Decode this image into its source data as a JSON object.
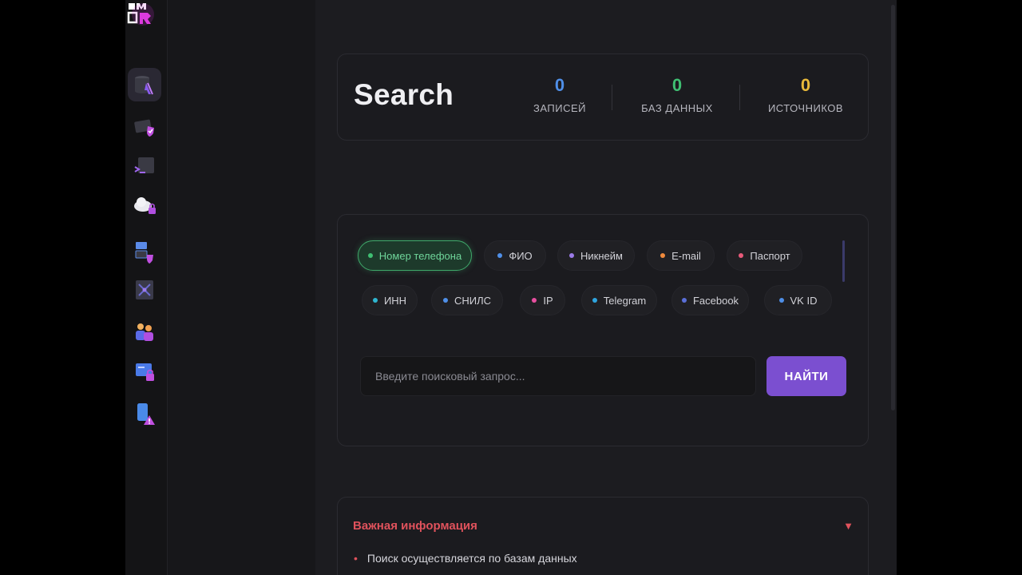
{
  "header": {
    "title": "Search",
    "stats": [
      {
        "value": "0",
        "label": "ЗАПИСЕЙ",
        "color": "#4f8fe8"
      },
      {
        "value": "0",
        "label": "БАЗ ДАННЫХ",
        "color": "#3fbf72"
      },
      {
        "value": "0",
        "label": "ИСТОЧНИКОВ",
        "color": "#e8b93a"
      }
    ]
  },
  "rail": {
    "icons": [
      "database-search-icon",
      "shield-card-icon",
      "terminal-icon",
      "cloud-lock-icon",
      "layers-shield-icon",
      "network-icon",
      "users-icon",
      "card-lock-icon",
      "phone-warning-icon"
    ]
  },
  "filters": {
    "row1": [
      {
        "label": "Номер телефона",
        "dot": "#3fbf72",
        "active": true
      },
      {
        "label": "ФИО",
        "dot": "#4f8fe8"
      },
      {
        "label": "Никнейм",
        "dot": "#9b7be8"
      },
      {
        "label": "E-mail",
        "dot": "#f08a3c"
      },
      {
        "label": "Паспорт",
        "dot": "#e85a7a"
      }
    ],
    "row2": [
      {
        "label": "ИНН",
        "dot": "#2fb5d0"
      },
      {
        "label": "СНИЛС",
        "dot": "#4f8fe8"
      },
      {
        "label": "IP",
        "dot": "#e84fa0"
      },
      {
        "label": "Telegram",
        "dot": "#2fa5e0"
      },
      {
        "label": "Facebook",
        "dot": "#5a6fd8"
      },
      {
        "label": "VK ID",
        "dot": "#4f8fe8"
      }
    ]
  },
  "search": {
    "placeholder": "Введите поисковый запрос...",
    "button_label": "НАЙТИ"
  },
  "info": {
    "title": "Важная информация",
    "bullet": "Поиск осуществляется по базам данных"
  },
  "colors": {
    "accent": "#7b4fd0",
    "danger": "#e0525c"
  }
}
